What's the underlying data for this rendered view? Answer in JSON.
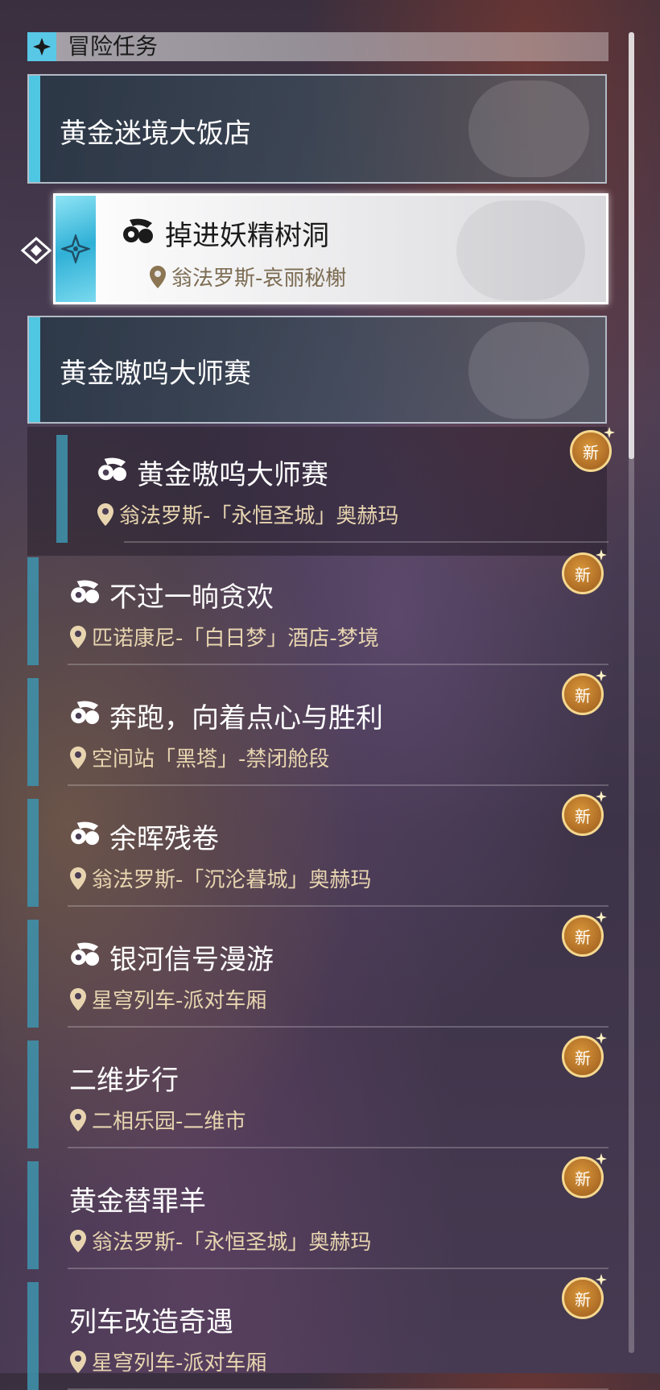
{
  "header": {
    "title": "冒险任务"
  },
  "categories": [
    {
      "label": "黄金迷境大饭店"
    },
    {
      "label": "黄金嗷呜大师赛"
    }
  ],
  "selected_quest": {
    "title": "掉进妖精树洞",
    "location": "翁法罗斯-哀丽秘榭"
  },
  "quests": [
    {
      "title": "黄金嗷呜大师赛",
      "location": "翁法罗斯-「永恒圣城」奥赫玛",
      "badge": "新"
    },
    {
      "title": "不过一晌贪欢",
      "location": "匹诺康尼-「白日梦」酒店-梦境",
      "badge": "新"
    },
    {
      "title": "奔跑，向着点心与胜利",
      "location": "空间站「黑塔」-禁闭舱段",
      "badge": "新"
    },
    {
      "title": "余晖残卷",
      "location": "翁法罗斯-「沉沦暮城」奥赫玛",
      "badge": "新"
    },
    {
      "title": "银河信号漫游",
      "location": "星穹列车-派对车厢",
      "badge": "新"
    },
    {
      "title": "二维步行",
      "location": "二相乐园-二维市",
      "badge": "新"
    },
    {
      "title": "黄金替罪羊",
      "location": "翁法罗斯-「永恒圣城」奥赫玛",
      "badge": "新"
    },
    {
      "title": "列车改造奇遇",
      "location": "星穹列车-派对车厢",
      "badge": "新"
    }
  ],
  "colors": {
    "accent": "#4fc6e2",
    "quest_bar": "#3f8fa8",
    "location_text": "#e8d5b0",
    "badge": "#c9832f"
  },
  "icons": {
    "header": "diamond-star-icon",
    "quest": "quest-ribbon-icon",
    "location": "map-pin-icon",
    "pointer": "selection-arrow-icon"
  }
}
